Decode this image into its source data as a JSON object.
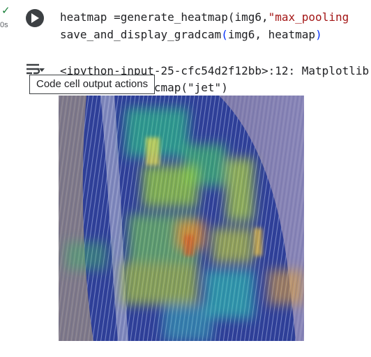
{
  "cell": {
    "status_icon": "check-icon",
    "exec_time": "0s",
    "run_icon": "play-icon",
    "code": {
      "line1_a": "heatmap =generate_heatmap(img6,",
      "line1_str": "\"max_pooling",
      "line2_a": "save_and_display_gradcam",
      "line2_open": "(",
      "line2_b": "img6, heatmap",
      "line2_close": ")"
    }
  },
  "output": {
    "actions_icon": "output-actions-icon",
    "line1": "<ipython-input-25-cfc54d2f12bb>:12: Matplotlib",
    "line2": "            t_cmap(\"jet\")",
    "tooltip": "Code cell output actions"
  },
  "image": {
    "subject": "gradcam-heatmap-overlay-leaf"
  }
}
